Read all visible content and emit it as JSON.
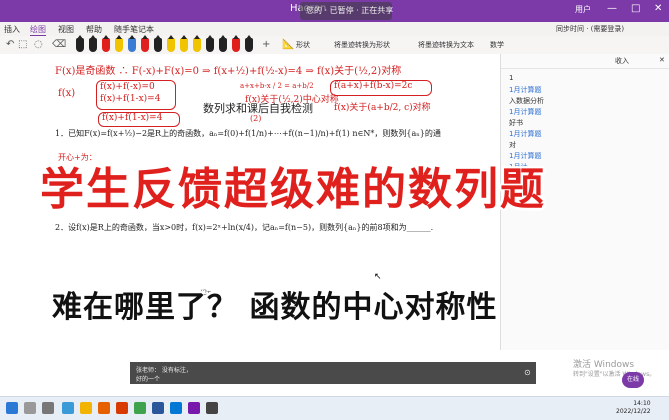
{
  "titlebar": {
    "window_name": "Haoran",
    "overlay_text": "您的 · 已暂停 · 正在共享",
    "user_label": "用户",
    "controls": [
      "—",
      "□",
      "✕"
    ]
  },
  "menu": {
    "items": [
      "插入",
      "绘图",
      "视图",
      "帮助",
      "随手笔记本"
    ],
    "active_index": 1,
    "right_text": "同步时间 · (需要登录)"
  },
  "ribbon": {
    "pens": [
      "#222222",
      "#222222",
      "#e0201c",
      "#f0c400",
      "#3a7bd5",
      "#e0201c",
      "#222222",
      "#f0c400",
      "#f0c400",
      "#f0c400",
      "#222222",
      "#222222",
      "#e0201c",
      "#222222"
    ],
    "labels": [
      "形状",
      "将墨迹转换为形状",
      "将墨迹转换为文本",
      "数学"
    ]
  },
  "document": {
    "title": "数列求和课后自我检测",
    "hw_line1": "F(x)是奇函数 ∴ F(-x)+F(x)=0 ⇒ f(x+½)+f(½-x)=4 ⇒ f(x)关于(½,2)对称",
    "hw_fx": "f(x)",
    "hw_box1a": "f(x)+f(-x)=0",
    "hw_box1b": "f(x)+f(1-x)=4",
    "hw_box2": "f(x)+f(1-x)=4",
    "hw_right1": "f(a+x)+f(b-x)=2c",
    "hw_right2": "f(x)关于(a+b/2, c)对称",
    "hw_center": "f(x)关于(½,2)中心对称",
    "hw_sub": "a+x+b-x / 2 = a+b/2",
    "hw_ex": "开心+为：",
    "q1": "1．已知F(x)=f(x+½)−2是R上的奇函数，aₙ=f(0)+f(1/n)+⋯+f((n−1)/n)+f(1) n∈N*，则数列{aₙ}的通",
    "q2": "2．设f(x)是R上的奇函数，当x>0时，f(x)=2ˣ+ln(x/4)，记aₙ=f(n−5)，则数列{aₙ}的前8项和为______.",
    "q_tail": "(2n",
    "q1_side": "|=",
    "q1_side2": "n",
    "ink_small": "(2)"
  },
  "captions": {
    "main": "学生反馈超级难的数列题",
    "sub": "难在哪里了？ 函数的中心对称性"
  },
  "right_panel": {
    "header": "收入",
    "close": "✕",
    "lines": [
      {
        "text": "1",
        "color": "#333333"
      },
      {
        "text": "1月计算题",
        "color": "#2b6fd6"
      },
      {
        "text": "入数据分析",
        "color": "#333333"
      },
      {
        "text": "1月计算题",
        "color": "#2b6fd6"
      },
      {
        "text": "好书",
        "color": "#333333"
      },
      {
        "text": "1月计算题",
        "color": "#2b6fd6"
      },
      {
        "text": "对",
        "color": "#333333"
      },
      {
        "text": "1月计算题",
        "color": "#2b6fd6"
      },
      {
        "text": "1月计",
        "color": "#2b6fd6"
      }
    ]
  },
  "notification": {
    "line1": "张老师：  没有标注，",
    "line2": "          好的一个",
    "close": "⊙"
  },
  "watermark": {
    "title": "激活 Windows",
    "sub": "转到\"设置\"以激活 Windows。"
  },
  "avatar_label": "在线",
  "taskbar": {
    "time": "14:10",
    "date": "2022/12/22"
  }
}
